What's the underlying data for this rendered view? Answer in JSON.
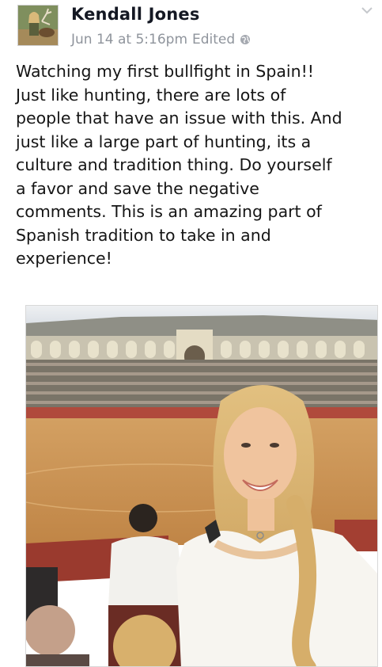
{
  "post": {
    "author": "Kendall Jones",
    "timestamp": "Jun 14 at 5:16pm",
    "edited_label": "Edited",
    "privacy_icon": "globe-icon",
    "text": "Watching my first bullfight in Spain!!\nJust like hunting, there are lots of\npeople that have an issue with this. And\njust like a large part of hunting, its a\nculture and tradition thing. Do yourself\na favor and save the negative\ncomments. This is an amazing part of\nSpanish tradition to take in and\nexperience!",
    "menu_icon": "chevron-down-icon"
  },
  "colors": {
    "name": "#141823",
    "meta": "#8f949c",
    "arena_sand": "#c9924f",
    "arena_wall": "#b04a3c"
  }
}
